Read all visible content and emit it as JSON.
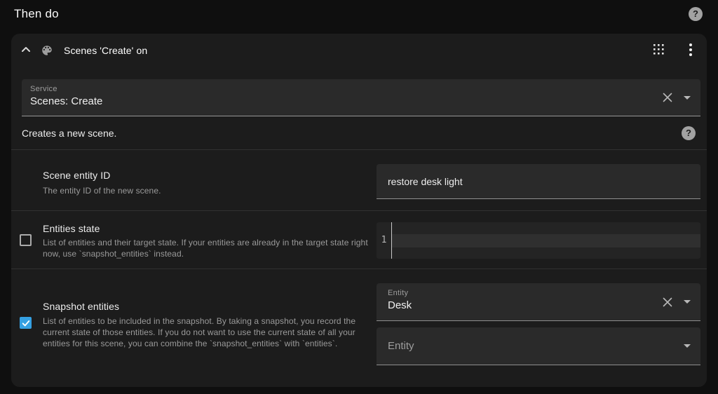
{
  "page": {
    "title": "Then do"
  },
  "icons": {
    "question_mark": "?",
    "header_icons": [
      "chevron-up",
      "palette",
      "grid",
      "kebab-menu"
    ],
    "field_icons": [
      "clear-x",
      "chevron-down"
    ]
  },
  "colors": {
    "page_background": "#0f0f0f",
    "card_background": "#1c1c1c",
    "field_background": "#2a2a2a",
    "accent_checkbox_blue": "#35a0e2",
    "secondary_text": "#9a9a9a"
  },
  "card": {
    "title": "Scenes 'Create' on",
    "service_field": {
      "label": "Service",
      "value": "Scenes: Create"
    },
    "description": "Creates a new scene.",
    "params": [
      {
        "title": "Scene entity ID",
        "description": "The entity ID of the new scene.",
        "input_value": "restore desk light"
      },
      {
        "title": "Entities state",
        "description": "List of entities and their target state. If your entities are already in the target state right now, use `snapshot_entities` instead.",
        "checked": false,
        "editor": {
          "line_number": "1",
          "content": ""
        }
      },
      {
        "title": "Snapshot entities",
        "description": "List of entities to be included in the snapshot. By taking a snapshot, you record the current state of those entities. If you do not want to use the current state of all your entities for this scene, you can combine the `snapshot_entities` with `entities`.",
        "checked": true,
        "entity_pickers": [
          {
            "label": "Entity",
            "value": "Desk"
          },
          {
            "placeholder": "Entity"
          }
        ]
      }
    ]
  }
}
